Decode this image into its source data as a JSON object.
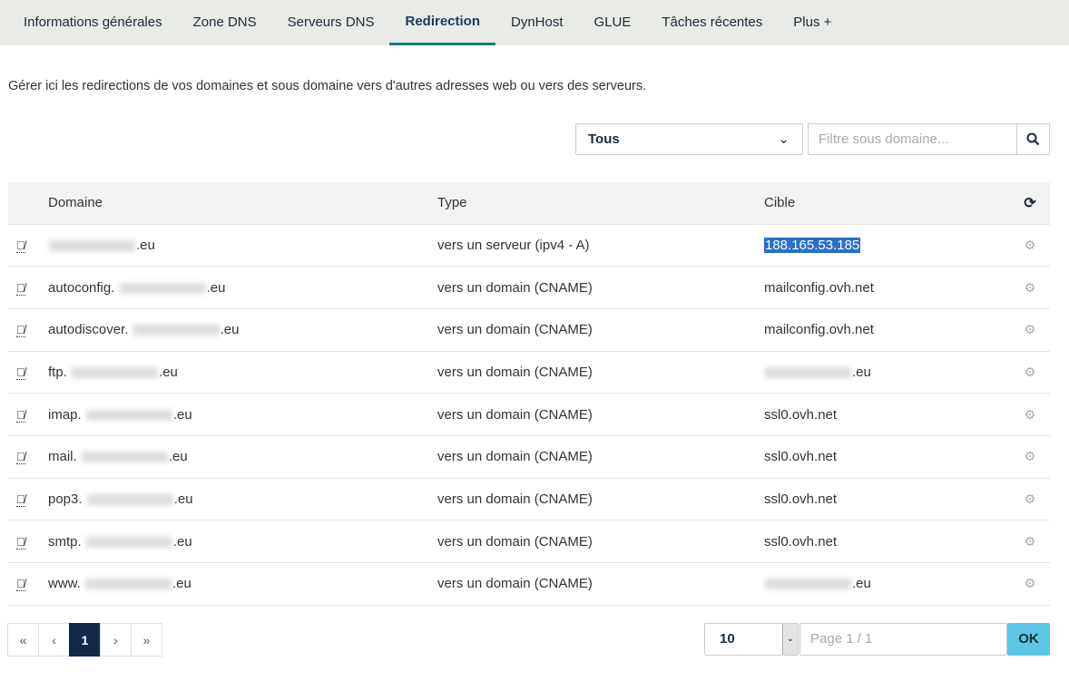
{
  "tabs": [
    "Informations générales",
    "Zone DNS",
    "Serveurs DNS",
    "Redirection",
    "DynHost",
    "GLUE",
    "Tâches récentes",
    "Plus +"
  ],
  "intro": "Gérer ici les redirections de vos domaines et sous domaine vers d'autres adresses web ou vers des serveurs.",
  "filter": {
    "type_value": "Tous",
    "search_placeholder": "Filtre sous domaine..."
  },
  "table": {
    "headers": [
      "Domaine",
      "Type",
      "Cible"
    ],
    "rows": [
      {
        "prefix": "",
        "suffix": ".eu",
        "type": "vers un serveur (ipv4 - A)",
        "target": "188.165.53.185",
        "target_blur": false,
        "selected": true
      },
      {
        "prefix": "autoconfig.",
        "suffix": ".eu",
        "type": "vers un domain (CNAME)",
        "target": "mailconfig.ovh.net",
        "target_blur": false
      },
      {
        "prefix": "autodiscover.",
        "suffix": ".eu",
        "type": "vers un domain (CNAME)",
        "target": "mailconfig.ovh.net",
        "target_blur": false
      },
      {
        "prefix": "ftp.",
        "suffix": ".eu",
        "type": "vers un domain (CNAME)",
        "target": ".eu",
        "target_blur": true
      },
      {
        "prefix": "imap.",
        "suffix": ".eu",
        "type": "vers un domain (CNAME)",
        "target": "ssl0.ovh.net",
        "target_blur": false
      },
      {
        "prefix": "mail.",
        "suffix": ".eu",
        "type": "vers un domain (CNAME)",
        "target": "ssl0.ovh.net",
        "target_blur": false
      },
      {
        "prefix": "pop3.",
        "suffix": ".eu",
        "type": "vers un domain (CNAME)",
        "target": "ssl0.ovh.net",
        "target_blur": false
      },
      {
        "prefix": "smtp.",
        "suffix": ".eu",
        "type": "vers un domain (CNAME)",
        "target": "ssl0.ovh.net",
        "target_blur": false
      },
      {
        "prefix": "www.",
        "suffix": ".eu",
        "type": "vers un domain (CNAME)",
        "target": ".eu",
        "target_blur": true
      }
    ]
  },
  "pagination": {
    "pages": [
      "«",
      "‹",
      "1",
      "›",
      "»"
    ],
    "current": "1",
    "page_size": "10",
    "page_placeholder": "Page 1 / 1",
    "ok_label": "OK"
  }
}
